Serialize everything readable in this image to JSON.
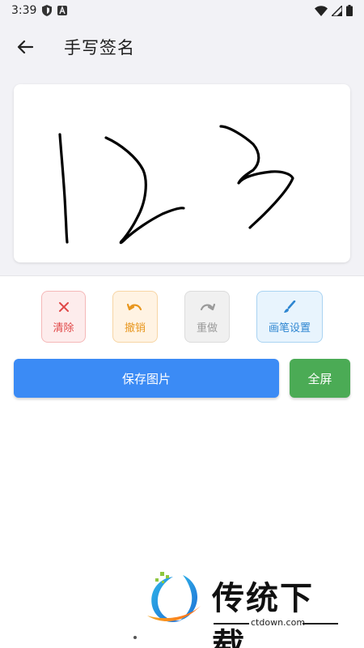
{
  "status_bar": {
    "time": "3:39",
    "icons": [
      "shield-icon",
      "a-icon",
      "wifi-icon",
      "signal-icon",
      "battery-icon"
    ]
  },
  "app_bar": {
    "back_icon": "arrow-left-icon",
    "title": "手写签名"
  },
  "canvas": {
    "stroke_color": "#000000",
    "content_description": ""
  },
  "tools": {
    "clear": {
      "label": "清除",
      "icon": "close-icon",
      "color": "#e04848"
    },
    "undo": {
      "label": "撤销",
      "icon": "undo-icon",
      "color": "#e8961d"
    },
    "redo": {
      "label": "重做",
      "icon": "redo-icon",
      "color": "#9a9a9a"
    },
    "pen_settings": {
      "label": "画笔设置",
      "icon": "brush-icon",
      "color": "#2e86d1"
    }
  },
  "actions": {
    "save_label": "保存图片",
    "fullscreen_label": "全屏",
    "save_color": "#3b8bf5",
    "fullscreen_color": "#4bab55"
  },
  "watermark": {
    "brand": "传统下载",
    "url": "ctdown.com"
  }
}
